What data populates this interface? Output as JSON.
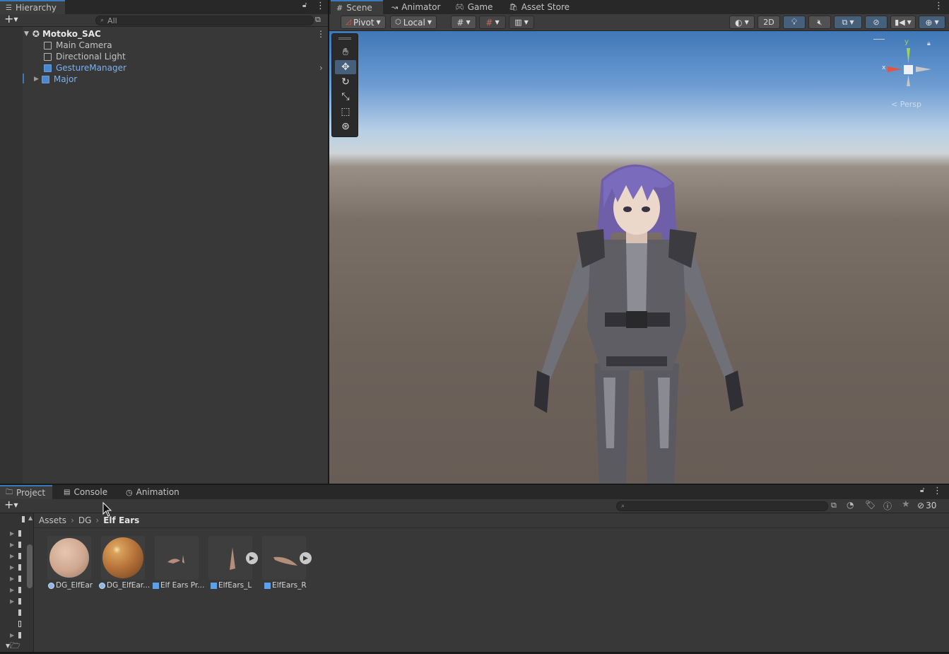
{
  "hierarchy": {
    "tab": "Hierarchy",
    "search_placeholder": "All",
    "scene_name": "Motoko_SAC",
    "items": [
      {
        "label": "Main Camera"
      },
      {
        "label": "Directional Light"
      },
      {
        "label": "GestureManager"
      },
      {
        "label": "Major"
      }
    ]
  },
  "scene_tabs": [
    "Scene",
    "Animator",
    "Game",
    "Asset Store"
  ],
  "scene_toolbar": {
    "pivot": "Pivot",
    "local": "Local",
    "mode_2d": "2D"
  },
  "gizmo": {
    "axis_y": "y",
    "axis_x": "x",
    "projection": "Persp"
  },
  "bottom_tabs": [
    "Project",
    "Console",
    "Animation"
  ],
  "project": {
    "breadcrumb": [
      "Assets",
      "DG",
      "Elf Ears"
    ],
    "hidden_count": "30",
    "assets": [
      {
        "label": "DG_ElfEar",
        "type": "material"
      },
      {
        "label": "DG_ElfEar...",
        "type": "material"
      },
      {
        "label": "Elf Ears Pr...",
        "type": "prefab"
      },
      {
        "label": "ElfEars_L",
        "type": "model"
      },
      {
        "label": "ElfEars_R",
        "type": "model"
      }
    ]
  },
  "colors": {
    "accent": "#3a79bb",
    "selected_text": "#7bb1ef",
    "panel": "#383838"
  }
}
